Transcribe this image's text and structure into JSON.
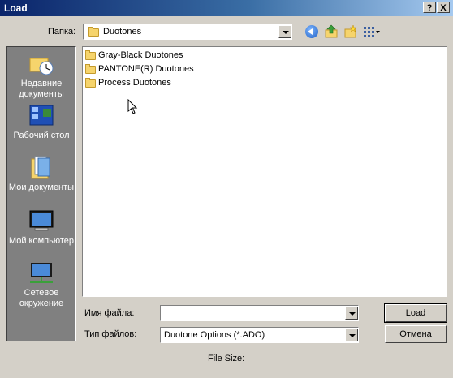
{
  "window": {
    "title": "Load",
    "help_label": "?",
    "close_label": "X"
  },
  "lookin": {
    "label": "Папка:",
    "value": "Duotones"
  },
  "places": [
    {
      "label": "Недавние документы",
      "icon": "recent-documents-icon"
    },
    {
      "label": "Рабочий стол",
      "icon": "desktop-icon"
    },
    {
      "label": "Мои документы",
      "icon": "my-documents-icon"
    },
    {
      "label": "Мой компьютер",
      "icon": "my-computer-icon"
    },
    {
      "label": "Сетевое окружение",
      "icon": "network-icon"
    }
  ],
  "files": [
    {
      "name": "Gray-Black Duotones"
    },
    {
      "name": "PANTONE(R) Duotones"
    },
    {
      "name": "Process Duotones"
    }
  ],
  "filename": {
    "label": "Имя файла:",
    "value": ""
  },
  "filetype": {
    "label": "Тип файлов:",
    "value": "Duotone Options (*.ADO)"
  },
  "buttons": {
    "load": "Load",
    "cancel": "Отмена"
  },
  "status": {
    "file_size": "File Size:"
  }
}
